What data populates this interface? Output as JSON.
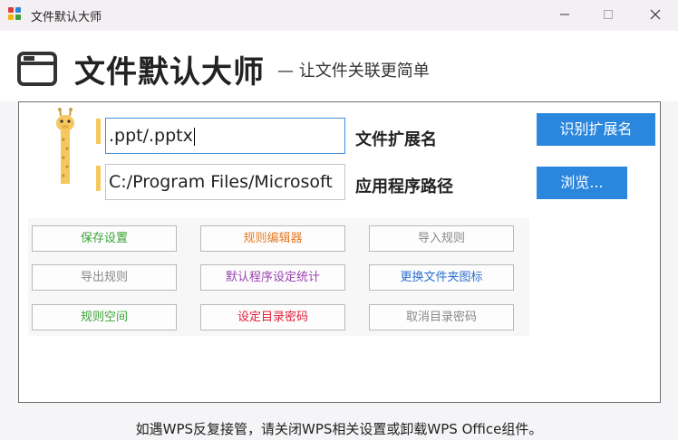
{
  "window": {
    "title": "文件默认大师",
    "minimize_icon": "minimize-icon",
    "maximize_icon": "maximize-icon",
    "close_icon": "close-icon"
  },
  "header": {
    "title": "文件默认大师",
    "subtitle": "— 让文件关联更简单",
    "logo_icon": "folder-window-icon"
  },
  "form": {
    "mascot_icon": "giraffe-icon",
    "extension": {
      "value": ".ppt/.pptx",
      "label": "文件扩展名",
      "button": "识别扩展名"
    },
    "app_path": {
      "value": "C:/Program Files/Microsoft",
      "label": "应用程序路径",
      "button": "浏览..."
    }
  },
  "rule_buttons": [
    {
      "label": "保存设置",
      "color": "#3aa336"
    },
    {
      "label": "规则编辑器",
      "color": "#e8791e"
    },
    {
      "label": "导入规则",
      "color": "#888888"
    },
    {
      "label": "导出规则",
      "color": "#888888"
    },
    {
      "label": "默认程序设定统计",
      "color": "#9b3fb0"
    },
    {
      "label": "更换文件夹图标",
      "color": "#2c6fd1"
    },
    {
      "label": "规则空间",
      "color": "#3aa336"
    },
    {
      "label": "设定目录密码",
      "color": "#e0203a"
    },
    {
      "label": "取消目录密码",
      "color": "#888888"
    }
  ],
  "footer": {
    "notice": "如遇WPS反复接管，请关闭WPS相关设置或卸载WPS Office组件。"
  },
  "colors": {
    "accent_blue": "#2b86dd",
    "marker_yellow": "#f4c85e",
    "titlebar_bg": "#f4eff3"
  }
}
